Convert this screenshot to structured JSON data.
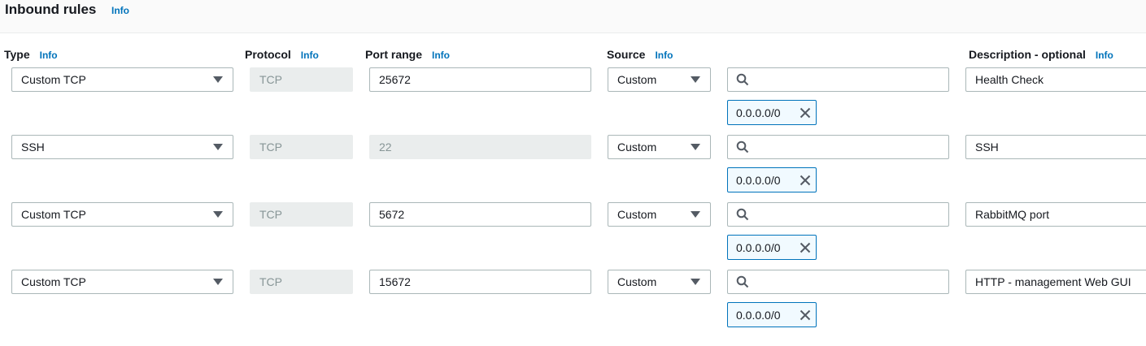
{
  "title": "Inbound rules",
  "info_label": "Info",
  "columns": {
    "type": "Type",
    "protocol": "Protocol",
    "port_range": "Port range",
    "source": "Source",
    "description": "Description - optional"
  },
  "rules": [
    {
      "type": "Custom TCP",
      "protocol": "TCP",
      "port": "25672",
      "port_disabled": false,
      "source": "Custom",
      "search_value": "",
      "cidr": "0.0.0.0/0",
      "description": "Health Check"
    },
    {
      "type": "SSH",
      "protocol": "TCP",
      "port": "22",
      "port_disabled": true,
      "source": "Custom",
      "search_value": "",
      "cidr": "0.0.0.0/0",
      "description": "SSH"
    },
    {
      "type": "Custom TCP",
      "protocol": "TCP",
      "port": "5672",
      "port_disabled": false,
      "source": "Custom",
      "search_value": "",
      "cidr": "0.0.0.0/0",
      "description": "RabbitMQ port"
    },
    {
      "type": "Custom TCP",
      "protocol": "TCP",
      "port": "15672",
      "port_disabled": false,
      "source": "Custom",
      "search_value": "",
      "cidr": "0.0.0.0/0",
      "description": "HTTP - management Web GUI"
    }
  ],
  "colors": {
    "link": "#0073bb",
    "token_border": "#0073bb",
    "token_bg": "#f1faff",
    "disabled_bg": "#eaeded"
  }
}
